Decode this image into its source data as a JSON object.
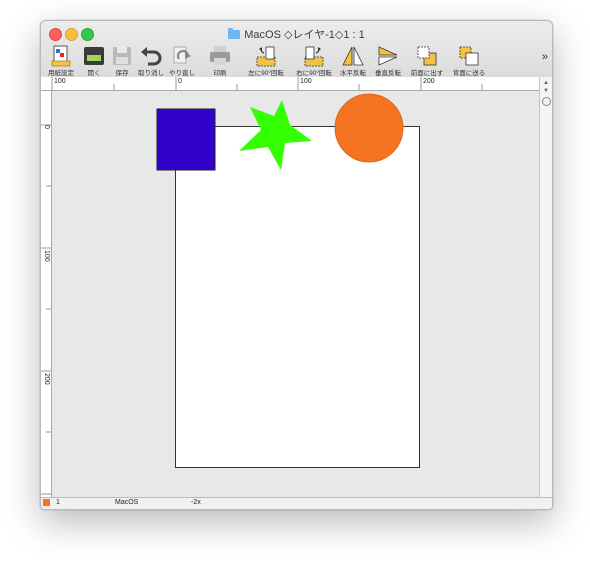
{
  "window": {
    "title": "MacOS ◇レイヤ-1◇1 : 1"
  },
  "toolbar": {
    "items": [
      {
        "label": "用紙設定",
        "icon": "page-setup-icon"
      },
      {
        "label": "開く",
        "icon": "open-icon"
      },
      {
        "label": "保存",
        "icon": "save-icon"
      },
      {
        "label": "取り消し",
        "icon": "undo-icon"
      },
      {
        "label": "やり直し",
        "icon": "redo-icon"
      },
      {
        "label": "印刷",
        "icon": "print-icon"
      },
      {
        "label": "左に90°回転",
        "icon": "rotate-left-icon"
      },
      {
        "label": "右に90°回転",
        "icon": "rotate-right-icon"
      },
      {
        "label": "水平反転",
        "icon": "flip-horizontal-icon"
      },
      {
        "label": "垂直反転",
        "icon": "flip-vertical-icon"
      },
      {
        "label": "前面に出す",
        "icon": "bring-front-icon"
      },
      {
        "label": "背面に送る",
        "icon": "send-back-icon"
      }
    ],
    "overflow": "»"
  },
  "ruler": {
    "top_labels": [
      "100",
      "0",
      "100",
      "200"
    ],
    "left_labels": [
      "0",
      "100",
      "200"
    ]
  },
  "shapes": [
    {
      "kind": "square",
      "color": "#3300cc"
    },
    {
      "kind": "star",
      "color": "#33ff00"
    },
    {
      "kind": "circle",
      "color": "#f47421"
    }
  ],
  "status": {
    "page_num": "1",
    "name": "MacOS",
    "zoom": "-2x"
  },
  "colors": {
    "status_swatch": "#f47421"
  }
}
